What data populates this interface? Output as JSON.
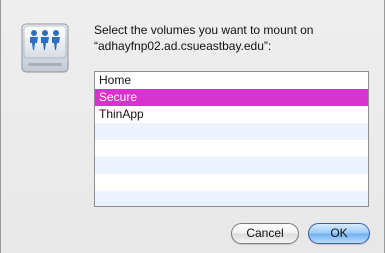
{
  "dialog": {
    "icon": "network-server-icon",
    "prompt": "Select the volumes you want to mount on “adhayfnp02.ad.csueastbay.edu”:"
  },
  "volumes": {
    "items": [
      {
        "label": "Home",
        "selected": false
      },
      {
        "label": "Secure",
        "selected": true
      },
      {
        "label": "ThinApp",
        "selected": false
      }
    ],
    "selection_color": "#d633cc",
    "alt_row_color": "#edf3fe"
  },
  "buttons": {
    "cancel_label": "Cancel",
    "ok_label": "OK"
  }
}
